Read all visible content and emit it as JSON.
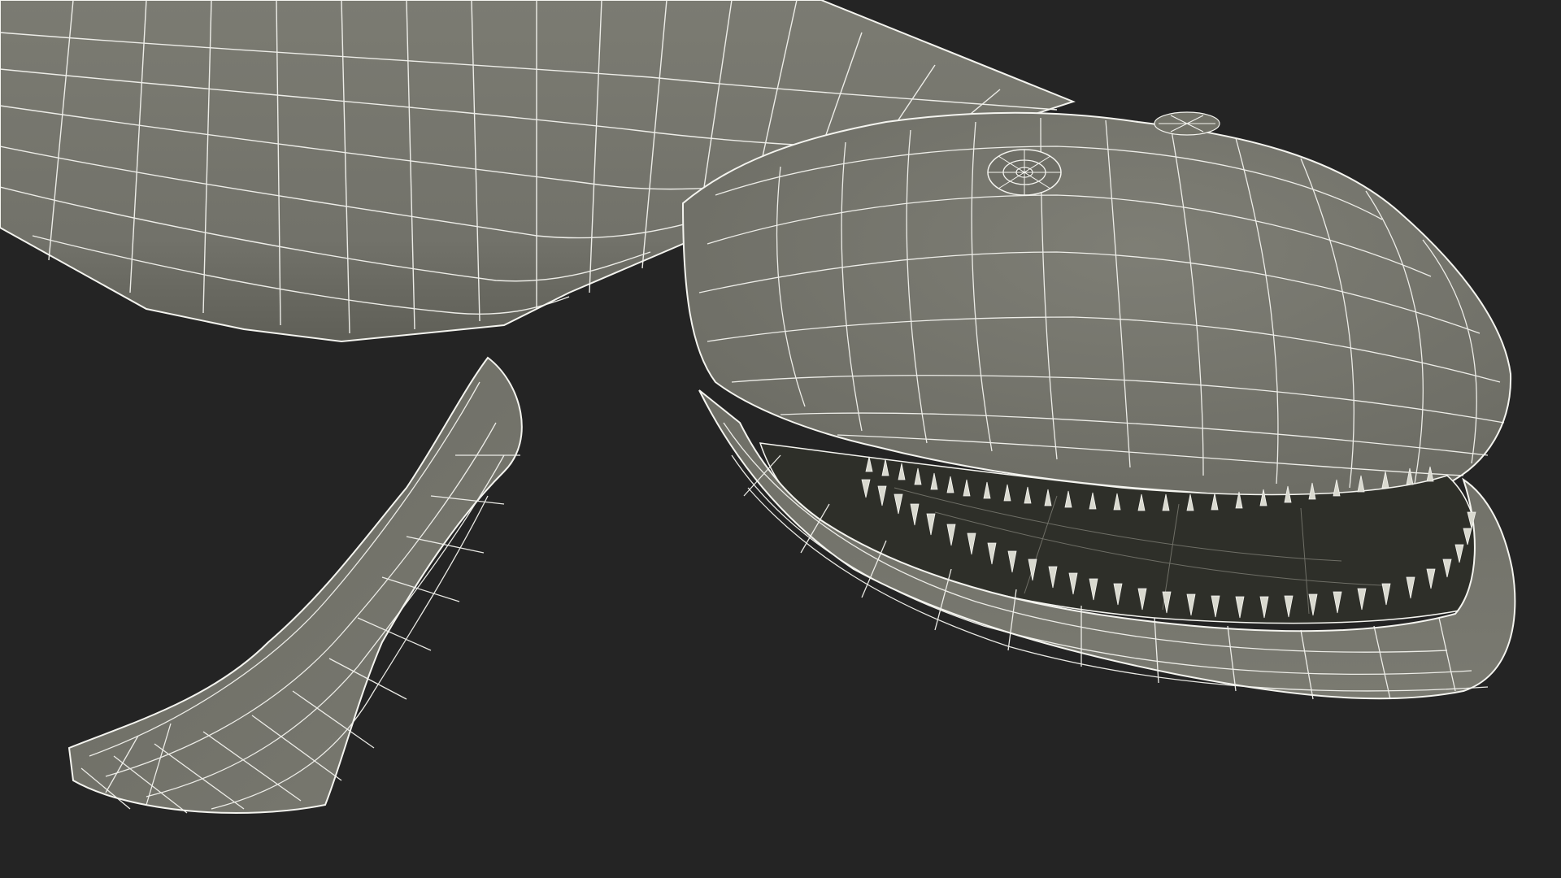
{
  "scene": {
    "subject": "whale-wireframe-model",
    "colors": {
      "background": "#242424",
      "surface": "#72726a",
      "surface_light": "#7c7c73",
      "surface_shadow": "#55554d",
      "mouth_interior": "#2e2f29",
      "wire": "#f4f4ef",
      "teeth": "#d9d9cf"
    }
  }
}
